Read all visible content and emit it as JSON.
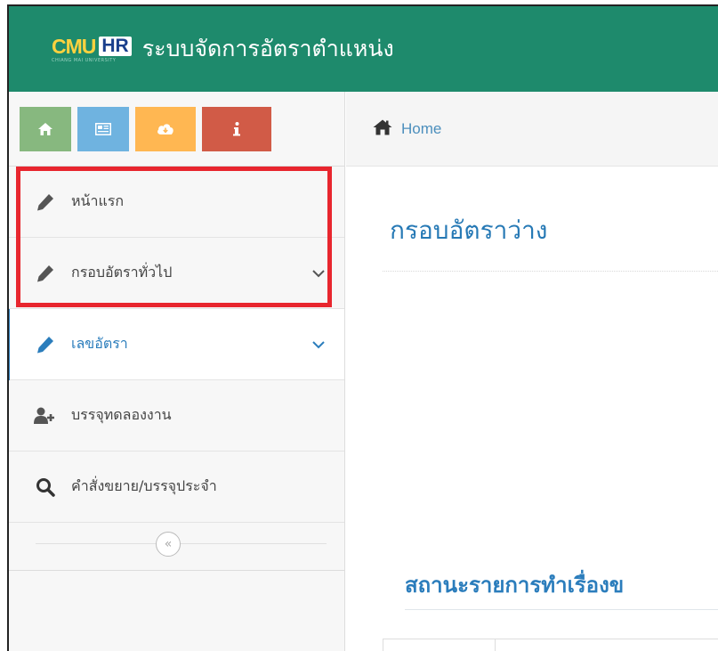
{
  "navbar": {
    "logo_main": "CMU",
    "logo_hr": "HR",
    "logo_sub": "CHIANG MAI UNIVERSITY",
    "app_title": "ระบบจัดการอัตราตำแหน่ง",
    "color": "#1e8a6c"
  },
  "shortcuts": [
    {
      "icon": "home-icon",
      "color": "#87b87f"
    },
    {
      "icon": "newspaper-icon",
      "color": "#6fb3e0"
    },
    {
      "icon": "cloud-download-icon",
      "color": "#ffb752"
    },
    {
      "icon": "info-icon",
      "color": "#d15b47"
    }
  ],
  "sidebar": {
    "items": [
      {
        "label": "หน้าแรก",
        "icon": "pencil-icon"
      },
      {
        "label": "กรอบอัตราทั่วไป",
        "icon": "pencil-icon",
        "has_submenu": true
      },
      {
        "label": "เลขอัตรา",
        "icon": "pencil-icon",
        "has_submenu": true,
        "active": true
      },
      {
        "label": "บรรจุทดลองงาน",
        "icon": "user-plus-icon"
      },
      {
        "label": "คำสั่งขยาย/บรรจุประจำ",
        "icon": "search-icon"
      }
    ],
    "collapse_glyph": "«"
  },
  "breadcrumb": {
    "home_label": "Home"
  },
  "main": {
    "page_title": "กรอบอัตราว่าง",
    "section_title": "สถานะรายการทำเรื่องข"
  },
  "colors": {
    "accent": "#2b7dbc",
    "highlight": "#e8262e"
  }
}
